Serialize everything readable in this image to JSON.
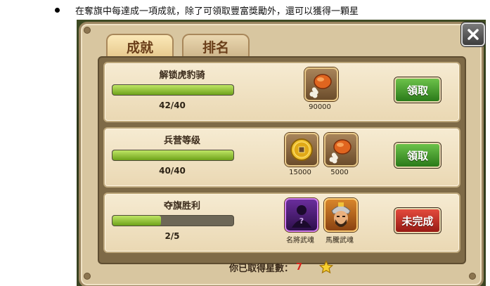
{
  "caption": "在奪旗中每達成一項成就，除了可領取豐富獎勵外，還可以獲得一顆星",
  "tabs": {
    "achievements": "成就",
    "ranking": "排名"
  },
  "rows": [
    {
      "title": "解锁虎豹骑",
      "progress_text": "42/40",
      "progress_fraction": 1.0,
      "rewards": [
        {
          "icon": "meat-drumstick-icon",
          "label": "90000"
        }
      ],
      "action": "領取",
      "action_color": "#2a7a19"
    },
    {
      "title": "兵营等级",
      "progress_text": "40/40",
      "progress_fraction": 1.0,
      "rewards": [
        {
          "icon": "gold-coin-icon",
          "label": "15000"
        },
        {
          "icon": "meat-drumstick-icon",
          "label": "5000"
        }
      ],
      "action": "領取",
      "action_color": "#2a7a19"
    },
    {
      "title": "夺旗胜利",
      "progress_text": "2/5",
      "progress_fraction": 0.4,
      "rewards": [
        {
          "icon": "mystery-general-icon",
          "label": "名將武魂"
        },
        {
          "icon": "ma-teng-general-icon",
          "label": "馬騰武魂"
        }
      ],
      "action": "未完成",
      "action_color": "#981a14"
    }
  ],
  "stars": {
    "label": "你已取得星數：",
    "count": "7",
    "icon": "star-icon"
  }
}
